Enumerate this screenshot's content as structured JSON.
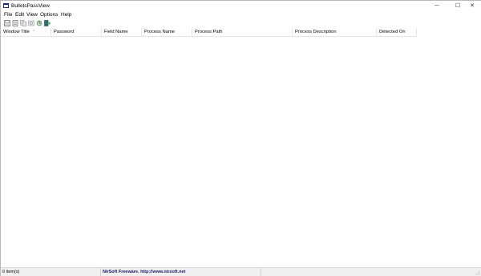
{
  "window": {
    "title": "BulletsPassView",
    "minimize_glyph": "—",
    "maximize_glyph": "☐",
    "close_glyph": "✕"
  },
  "menu": [
    "File",
    "Edit",
    "View",
    "Options",
    "Help"
  ],
  "toolbar": {
    "buttons": [
      "save-icon",
      "properties-icon",
      "copy-icon",
      "html-report-icon",
      "refresh-icon",
      "exit-icon"
    ]
  },
  "columns": [
    "Window Title",
    "Password",
    "Field Name",
    "Process Name",
    "Process Path",
    "Process Description",
    "Detected On"
  ],
  "sort_indicator": "^",
  "status": {
    "items": "0 item(s)",
    "credit": "NirSoft Freeware.  http://www.nirsoft.net"
  },
  "colors": {
    "titlebar": "#ffffff",
    "statusbar": "#f0f0f0",
    "grid": "#e3e3e3"
  }
}
